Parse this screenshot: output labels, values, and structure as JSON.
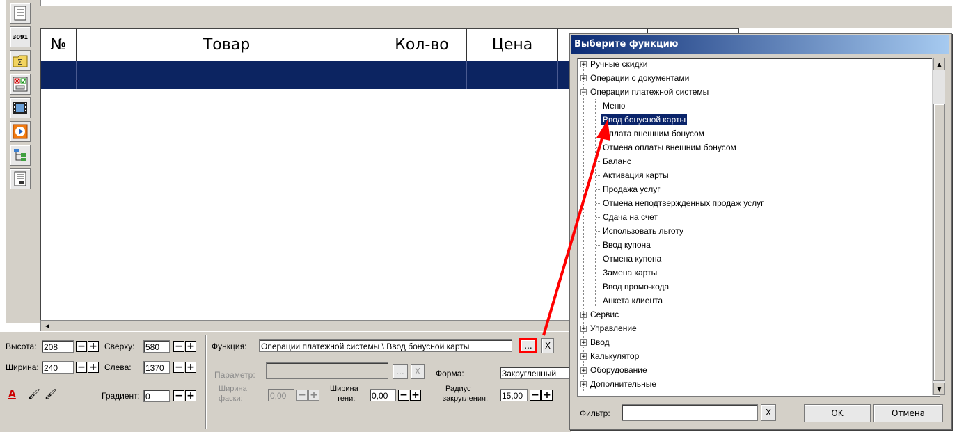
{
  "grid": {
    "headers": [
      "№",
      "Товар",
      "Кол-во",
      "Цена"
    ]
  },
  "bottom": {
    "height_label": "Высота:",
    "height_value": "208",
    "top_label": "Сверху:",
    "top_value": "580",
    "width_label": "Ширина:",
    "width_value": "240",
    "left_label": "Слева:",
    "left_value": "1370",
    "gradient_label": "Градиент:",
    "gradient_value": "0",
    "function_label": "Функция:",
    "function_value": "Операции платежной системы \\ Ввод бонусной карты",
    "function_browse": "...",
    "function_clear": "X",
    "param_label": "Параметр:",
    "param_browse": "...",
    "param_clear": "X",
    "form_label": "Форма:",
    "form_value": "Закругленный",
    "chamfer_label_1": "Ширина",
    "chamfer_label_2": "фаски:",
    "chamfer_value": "0,00",
    "shadow_label_1": "Ширина",
    "shadow_label_2": "тени:",
    "shadow_value": "0,00",
    "radius_label_1": "Радиус",
    "radius_label_2": "закругления:",
    "radius_value": "15,00"
  },
  "toolbar": {
    "icons": [
      "receipt-icon",
      "counter-3091-icon",
      "folder-sum-icon",
      "checkbox-form-icon",
      "film-icon",
      "play-icon",
      "tree-icon",
      "receipt-003-icon"
    ],
    "counter_text": "3091"
  },
  "dialog": {
    "title": "Выберите функцию",
    "tree": [
      {
        "label": "Ручные скидки",
        "expanded": false
      },
      {
        "label": "Операции с документами",
        "expanded": false
      },
      {
        "label": "Операции платежной системы",
        "expanded": true,
        "children": [
          "Меню",
          "Ввод бонусной карты",
          "Оплата внешним бонусом",
          "Отмена оплаты внешним бонусом",
          "Баланс",
          "Активация карты",
          "Продажа услуг",
          "Отмена неподтвержденных продаж услуг",
          "Сдача на счет",
          "Использовать льготу",
          "Ввод купона",
          "Отмена купона",
          "Замена карты",
          "Ввод промо-кода",
          "Анкета клиента"
        ]
      },
      {
        "label": "Сервис",
        "expanded": false
      },
      {
        "label": "Управление",
        "expanded": false
      },
      {
        "label": "Ввод",
        "expanded": false
      },
      {
        "label": "Калькулятор",
        "expanded": false
      },
      {
        "label": "Оборудование",
        "expanded": false
      },
      {
        "label": "Дополнительные",
        "expanded": false
      }
    ],
    "selected": "Ввод бонусной карты",
    "filter_label": "Фильтр:",
    "filter_value": "",
    "filter_clear": "X",
    "ok_label": "OK",
    "cancel_label": "Отмена"
  },
  "colors": {
    "selection": "#0a246a",
    "annotation": "#ff0000",
    "face": "#d4d0c8"
  }
}
